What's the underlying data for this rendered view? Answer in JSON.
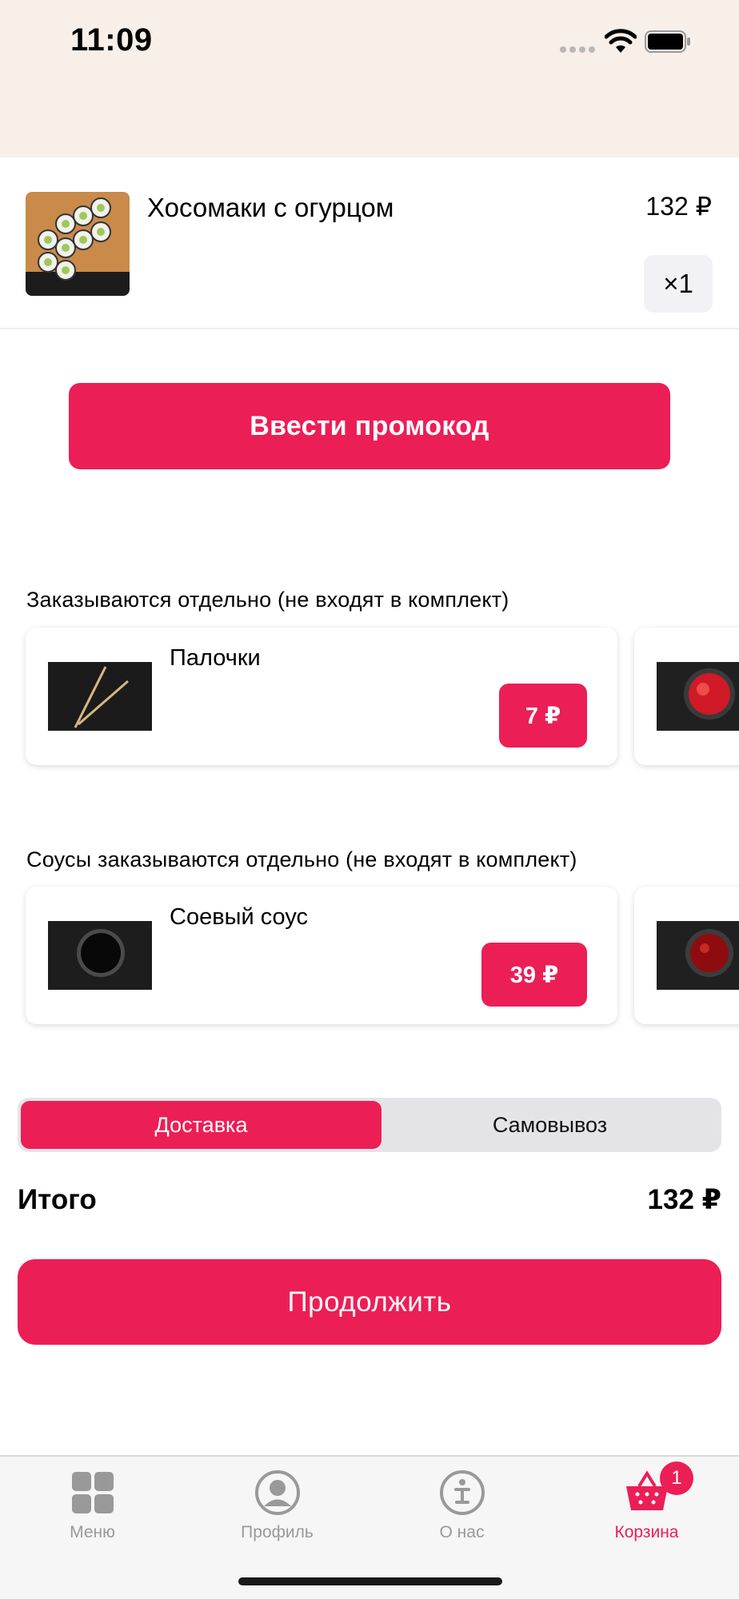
{
  "status_bar": {
    "time": "11:09"
  },
  "cart": {
    "item": {
      "name": "Хосомаки с огурцом",
      "price": "132 ₽",
      "quantity": "×1"
    }
  },
  "promo": {
    "label": "Ввести промокод"
  },
  "extras": {
    "title": "Заказываются отдельно (не входят в комплект)",
    "items": [
      {
        "name": "Палочки",
        "price": "7 ₽"
      }
    ]
  },
  "sauces": {
    "title": "Соусы заказываются отдельно (не входят в комплект)",
    "items": [
      {
        "name": "Соевый соус",
        "price": "39 ₽"
      }
    ]
  },
  "delivery_toggle": {
    "options": [
      "Доставка",
      "Самовывоз"
    ],
    "selected": "Доставка"
  },
  "total": {
    "label": "Итого",
    "value": "132 ₽"
  },
  "continue": {
    "label": "Продолжить"
  },
  "tabbar": {
    "items": [
      {
        "label": "Меню",
        "icon": "grid-icon"
      },
      {
        "label": "Профиль",
        "icon": "profile-icon"
      },
      {
        "label": "О нас",
        "icon": "info-icon"
      },
      {
        "label": "Корзина",
        "icon": "basket-icon"
      }
    ],
    "cart_badge": "1"
  },
  "colors": {
    "accent": "#ec1e56",
    "status_bg": "#f8efe9",
    "tab_inactive": "#999999"
  }
}
